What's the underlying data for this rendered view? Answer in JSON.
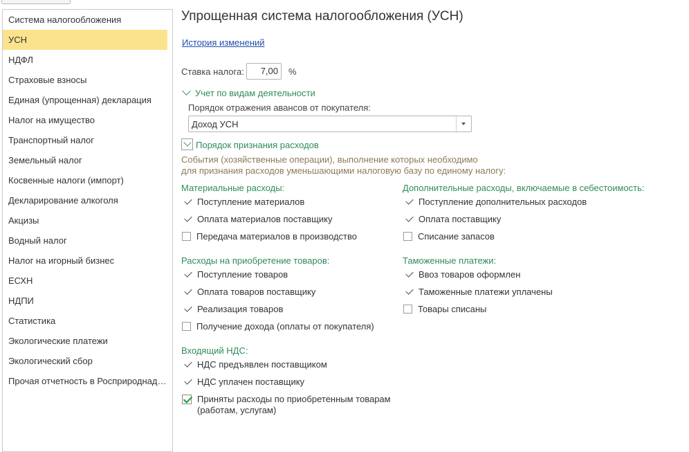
{
  "sidebar": {
    "items": [
      {
        "label": "Система налогообложения",
        "active": false
      },
      {
        "label": "УСН",
        "active": true
      },
      {
        "label": "НДФЛ",
        "active": false
      },
      {
        "label": "Страховые взносы",
        "active": false
      },
      {
        "label": "Единая (упрощенная) декларация",
        "active": false
      },
      {
        "label": "Налог на имущество",
        "active": false
      },
      {
        "label": "Транспортный налог",
        "active": false
      },
      {
        "label": "Земельный налог",
        "active": false
      },
      {
        "label": "Косвенные налоги (импорт)",
        "active": false
      },
      {
        "label": "Декларирование алкоголя",
        "active": false
      },
      {
        "label": "Акцизы",
        "active": false
      },
      {
        "label": "Водный налог",
        "active": false
      },
      {
        "label": "Налог на игорный бизнес",
        "active": false
      },
      {
        "label": "ЕСХН",
        "active": false
      },
      {
        "label": "НДПИ",
        "active": false
      },
      {
        "label": "Статистика",
        "active": false
      },
      {
        "label": "Экологические платежи",
        "active": false
      },
      {
        "label": "Экологический сбор",
        "active": false
      },
      {
        "label": "Прочая отчетность в Росприроднадзор",
        "active": false
      }
    ]
  },
  "main": {
    "title": "Упрощенная система налогообложения (УСН)",
    "history_link": "История изменений",
    "rate": {
      "label": "Ставка налога:",
      "value": "7,00",
      "unit": "%"
    },
    "activity_section": {
      "title": "Учет по видам деятельности",
      "advance_label": "Порядок отражения авансов от покупателя:",
      "advance_value": "Доход УСН"
    },
    "expenses_section": {
      "title": "Порядок признания расходов",
      "desc_line1": "События (хозяйственные операции), выполнение которых необходимо",
      "desc_line2": "для признания расходов уменьшающими налоговую базу по единому налогу:"
    },
    "groups": {
      "material": {
        "title": "Материальные расходы:",
        "items": [
          "Поступление материалов",
          "Оплата материалов поставщику",
          "Передача материалов в производство"
        ]
      },
      "additional": {
        "title": "Дополнительные расходы, включаемые в себестоимость:",
        "items": [
          "Поступление дополнительных расходов",
          "Оплата поставщику",
          "Списание запасов"
        ]
      },
      "goods": {
        "title": "Расходы на приобретение товаров:",
        "items": [
          "Поступление товаров",
          "Оплата товаров поставщику",
          "Реализация товаров",
          "Получение дохода (оплаты от покупателя)"
        ]
      },
      "customs": {
        "title": "Таможенные платежи:",
        "items": [
          "Ввоз товаров оформлен",
          "Таможенные платежи уплачены",
          "Товары списаны"
        ]
      },
      "vat": {
        "title": "Входящий НДС:",
        "items": [
          "НДС предъявлен поставщиком",
          "НДС уплачен поставщику",
          "Приняты расходы по приобретенным товарам",
          "(работам, услугам)"
        ]
      }
    }
  }
}
